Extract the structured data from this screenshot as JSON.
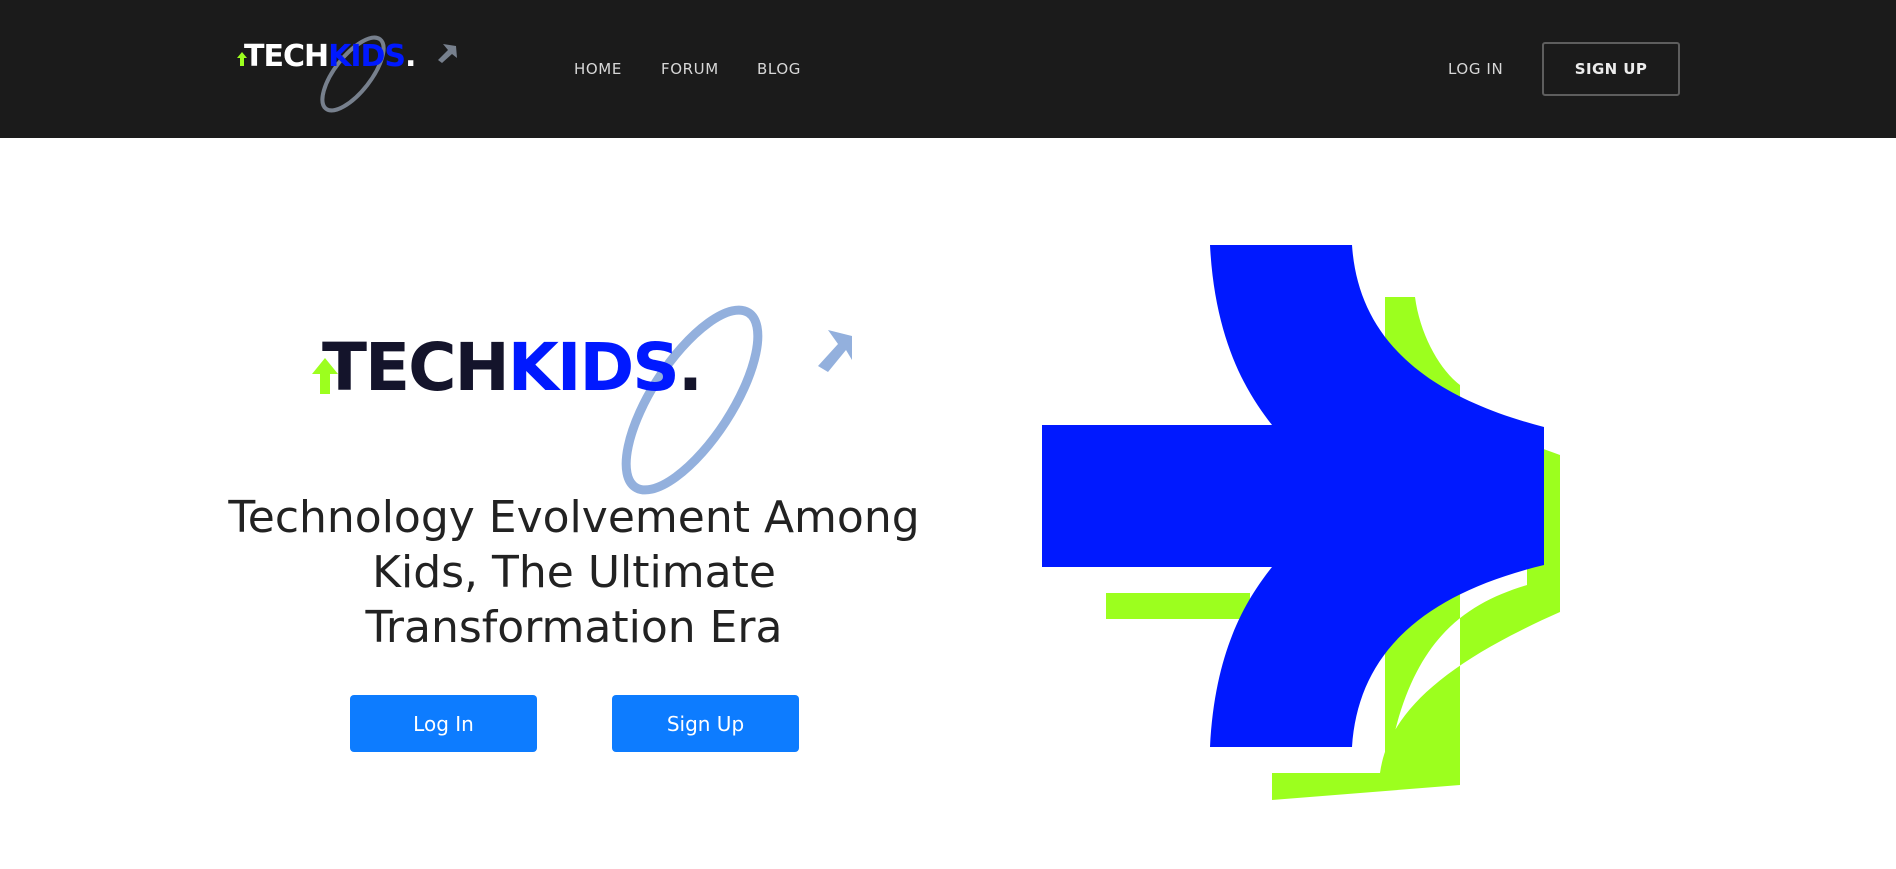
{
  "brand": {
    "name_part1": "TECH",
    "name_part2": "KIDS",
    "name_dot": ".",
    "colors": {
      "primary_blue": "#0019ff",
      "lime": "#9cff1e",
      "orbit_nav": "#77808d",
      "orbit_hero": "#93b0dd",
      "nav_background": "#1b1b1b",
      "button_blue": "#0d7cff"
    }
  },
  "nav": {
    "links": [
      "HOME",
      "FORUM",
      "BLOG"
    ],
    "login_label": "LOG IN",
    "signup_label": "SIGN UP"
  },
  "hero": {
    "title": "Technology Evolvement Among Kids, The Ultimate Transformation Era",
    "login_button": "Log In",
    "signup_button": "Sign Up",
    "graphic_icon": "arrow-right-icon"
  }
}
